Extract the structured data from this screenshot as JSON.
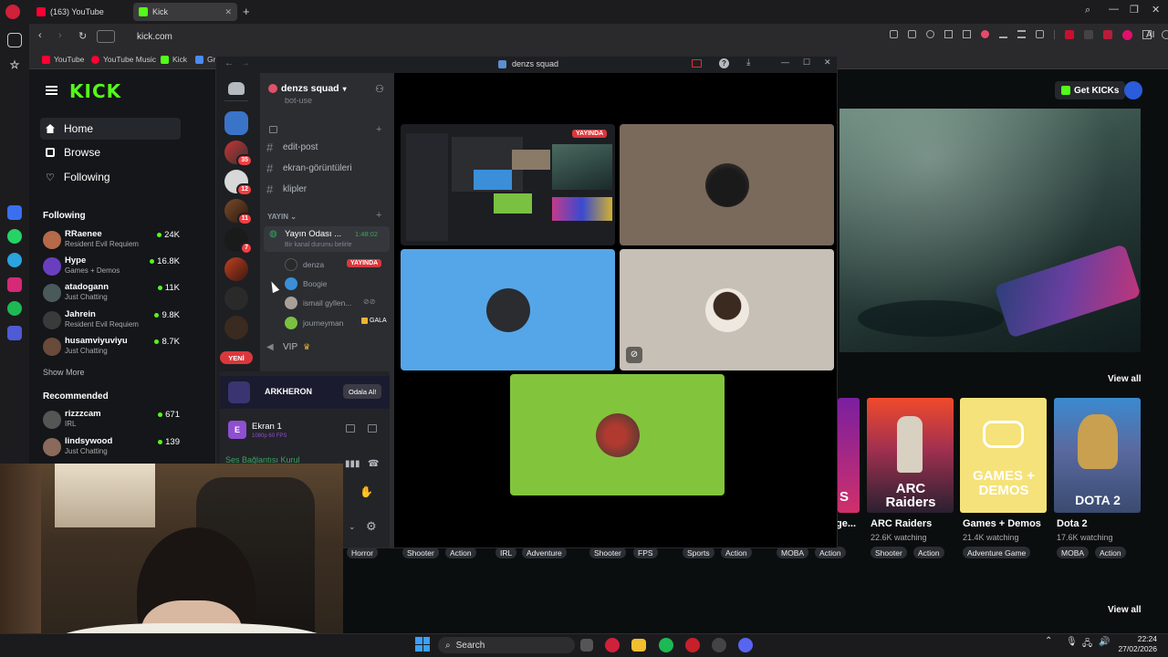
{
  "browser": {
    "tabs": [
      {
        "label": "(163) YouTube",
        "active": false
      },
      {
        "label": "Kick",
        "active": true
      }
    ],
    "new_tab": "+",
    "address": "kick.com",
    "ext_label": "AI",
    "bookmarks": [
      "YouTube",
      "YouTube Music",
      "Kick",
      "Gr"
    ]
  },
  "kick": {
    "logo": "KICK",
    "nav": [
      {
        "label": "Home",
        "icon": "home-icon",
        "active": true
      },
      {
        "label": "Browse",
        "icon": "browse-icon",
        "active": false
      },
      {
        "label": "Following",
        "icon": "heart-icon",
        "active": false
      }
    ],
    "following_title": "Following",
    "following": [
      {
        "name": "RRaenee",
        "game": "Resident Evil Requiem",
        "viewers": "24K",
        "color": "#b56a4a"
      },
      {
        "name": "Hype",
        "game": "Games + Demos",
        "viewers": "16.8K",
        "color": "#6a3fbf"
      },
      {
        "name": "atadogann",
        "game": "Just Chatting",
        "viewers": "11K",
        "color": "#4a5a5a"
      },
      {
        "name": "Jahrein",
        "game": "Resident Evil Requiem",
        "viewers": "9.8K",
        "color": "#3a3a3a"
      },
      {
        "name": "husamviyuviyu",
        "game": "Just Chatting",
        "viewers": "8.7K",
        "color": "#6a4a3a"
      }
    ],
    "show_more": "Show More",
    "recommended_title": "Recommended",
    "recommended": [
      {
        "name": "rizzzcam",
        "game": "IRL",
        "viewers": "671",
        "color": "#555"
      },
      {
        "name": "lindsywood",
        "game": "Just Chatting",
        "viewers": "139",
        "color": "#8a6a5a"
      }
    ],
    "get_kicks": "Get KICKs",
    "view_all_1": "View all",
    "view_all_2": "View all",
    "categories": [
      {
        "title": "ARC Raiders",
        "watching": "22.6K watching",
        "tags": [
          "Shooter",
          "Action"
        ]
      },
      {
        "title": "Games + Demos",
        "watching": "21.4K watching",
        "tags": [
          "Adventure Game"
        ]
      },
      {
        "title": "Dota 2",
        "watching": "17.6K watching",
        "tags": [
          "MOBA",
          "Action"
        ]
      }
    ],
    "partial_title": "ge...",
    "cover_text": {
      "arc": "ARC Raiders",
      "games": "GAMES + DEMOS",
      "dota": "DOTA 2",
      "partial": "S"
    },
    "row_tags": [
      "Horror",
      "Shooter",
      "Action",
      "IRL",
      "Adventure",
      "Shooter",
      "FPS",
      "Sports",
      "Action",
      "MOBA",
      "Action"
    ]
  },
  "discord": {
    "window_title": "denzs squad",
    "guild_name": "denzs squad",
    "server_badges": [
      "35",
      "12",
      "11",
      "7"
    ],
    "partial_channel": "bot-use",
    "text_channels": [
      "edit-post",
      "ekran-görüntüleri",
      "klipler"
    ],
    "category": "YAYIN",
    "voice_room": {
      "name": "Yayın Odası ...",
      "timer": "1:48:02",
      "status": "Bir kanal durumu belirle"
    },
    "voice_users": [
      {
        "name": "denza",
        "badge": "YAYINDA"
      },
      {
        "name": "Boogie",
        "badge": ""
      },
      {
        "name": "ismail gyllen...",
        "badge": ""
      },
      {
        "name": "journeyman",
        "badge": "GALA"
      }
    ],
    "vip_channel": "VIP",
    "new_label": "YENİ",
    "promo": {
      "name": "ARKHERON",
      "button": "Odala Al!"
    },
    "activity": {
      "title": "Ekran 1",
      "sub": "1080p 60 FPS"
    },
    "connection": "Ses Bağlantısı Kurul",
    "live_tile_label": "YAYINDA"
  },
  "taskbar": {
    "search": "Search",
    "time": "22:24",
    "date": "27/02/2026"
  }
}
